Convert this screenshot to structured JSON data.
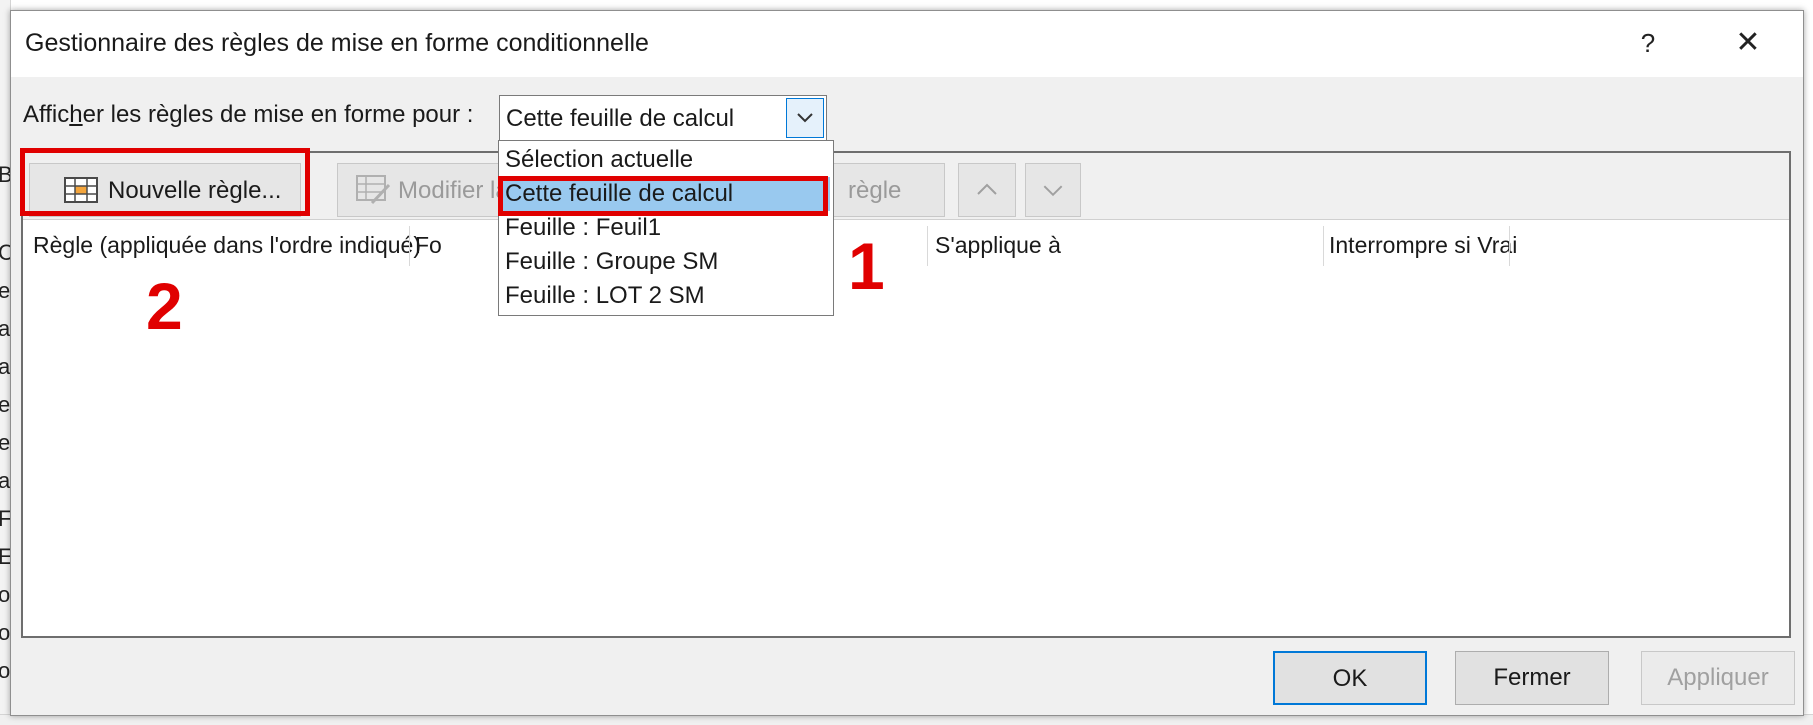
{
  "dialog": {
    "title": "Gestionnaire des règles de mise en forme conditionnelle",
    "help": "?",
    "close": "✕"
  },
  "scope": {
    "label_pre": "Affic",
    "label_accel": "h",
    "label_post": "er les règles de mise en forme pour :",
    "value": "Cette feuille de calcul",
    "arrow": "⌄"
  },
  "toolbar": {
    "new_rule": "Nouvelle règle...",
    "edit_rule": "Modifier la",
    "delete_rule": "règle",
    "move_up": "⌃",
    "move_down": "⌄"
  },
  "columns": {
    "rule": "Règle (appliquée dans l'ordre indiqué)",
    "format": "Fo",
    "applies_to": "S'applique à",
    "stop_if_true": "Interrompre si Vrai"
  },
  "dropdown": {
    "options": [
      "Sélection actuelle",
      "Cette feuille de calcul",
      "Feuille : Feuil1",
      "Feuille : Groupe SM",
      "Feuille : LOT 2 SM"
    ],
    "selected_index": 1
  },
  "annotations": {
    "step1": "1",
    "step2": "2",
    "color": "#e00000"
  },
  "buttons": {
    "ok": "OK",
    "cancel": "Fermer",
    "apply": "Appliquer"
  },
  "background_sheet": {
    "letters": [
      "B",
      "C",
      "e",
      "a",
      "a",
      "e",
      "e",
      "a",
      "F",
      "E",
      "o",
      "o",
      "o"
    ]
  },
  "colors": {
    "selection": "#99c9ef",
    "focus_border": "#0078d7"
  }
}
